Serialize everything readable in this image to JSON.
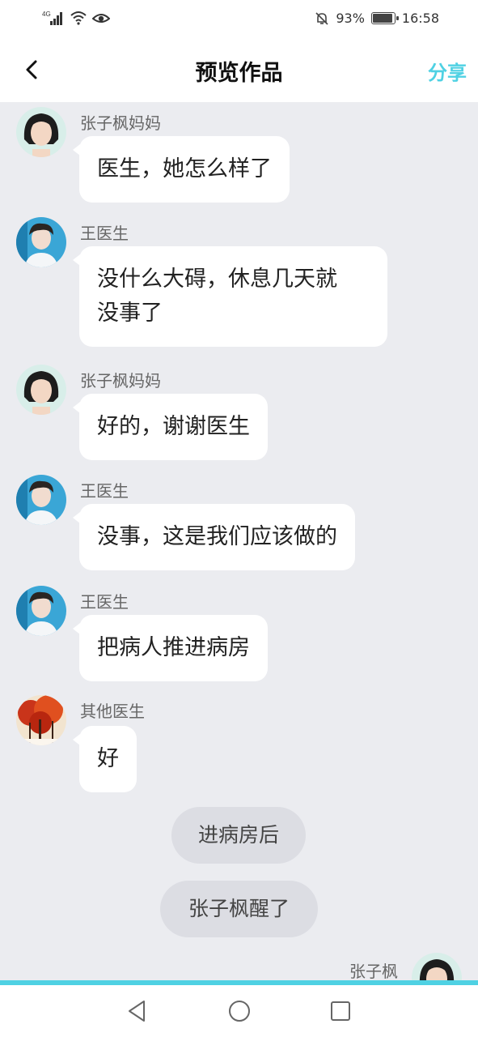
{
  "status_bar": {
    "network_label": "4G",
    "battery": "93%",
    "battery_level": 0.93,
    "time": "16:58"
  },
  "header": {
    "title": "预览作品",
    "share_label": "分享"
  },
  "messages": [
    {
      "sender": "张子枫妈妈",
      "text": "医生，她怎么样了",
      "avatar": "girl-portrait"
    },
    {
      "sender": "王医生",
      "text_lines": [
        "没什么大碍，休息几天就",
        "没事了"
      ],
      "avatar": "doctor-portrait"
    },
    {
      "sender": "张子枫妈妈",
      "text": "好的，谢谢医生",
      "avatar": "girl-portrait"
    },
    {
      "sender": "王医生",
      "text": "没事，这是我们应该做的",
      "avatar": "doctor-portrait"
    },
    {
      "sender": "王医生",
      "text": "把病人推进病房",
      "avatar": "doctor-portrait"
    },
    {
      "sender": "其他医生",
      "text": "好",
      "avatar": "autumn-tree-image"
    }
  ],
  "narrations": [
    "进病房后",
    "张子枫醒了"
  ],
  "partial_message": {
    "sender": "张子枫",
    "avatar": "girl-portrait"
  },
  "nav": {
    "icons": [
      "back-triangle-icon",
      "home-circle-icon",
      "recents-square-icon"
    ]
  },
  "colors": {
    "accent": "#4fd1e3",
    "chat_bg": "#ebecf0",
    "bubble_bg": "#ffffff",
    "narration_bg": "#dcdde3"
  }
}
